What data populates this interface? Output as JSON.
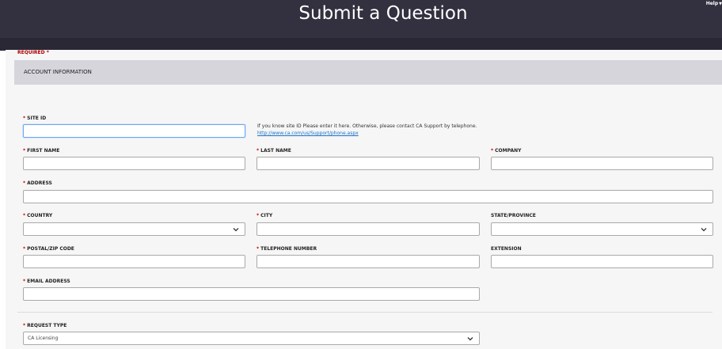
{
  "header": {
    "title": "Submit a Question",
    "help_label": "Help"
  },
  "section": {
    "title": "ACCOUNT INFORMATION",
    "required_note": "REQUIRED *"
  },
  "fields": {
    "site_id": {
      "label": "SITE ID",
      "required": true,
      "value": ""
    },
    "site_id_help": {
      "text": "If you know site ID Please enter it here. Otherwise, please contact CA Support by telephone.",
      "link": "http://www.ca.com/us/Support/phone.aspx"
    },
    "first_name": {
      "label": "FIRST NAME",
      "required": true,
      "value": ""
    },
    "last_name": {
      "label": "LAST NAME",
      "required": true,
      "value": ""
    },
    "company": {
      "label": "COMPANY",
      "required": true,
      "value": ""
    },
    "address": {
      "label": "ADDRESS",
      "required": true,
      "value": ""
    },
    "country": {
      "label": "COUNTRY",
      "required": true,
      "value": ""
    },
    "city": {
      "label": "CITY",
      "required": true,
      "value": ""
    },
    "state": {
      "label": "STATE/PROVINCE",
      "required": false,
      "value": ""
    },
    "postal": {
      "label": "POSTAL/ZIP CODE",
      "required": true,
      "value": ""
    },
    "telephone": {
      "label": "TELEPHONE NUMBER",
      "required": true,
      "value": ""
    },
    "extension": {
      "label": "EXTENSION",
      "required": false,
      "value": ""
    },
    "email": {
      "label": "EMAIL ADDRESS",
      "required": true,
      "value": ""
    },
    "request_type": {
      "label": "REQUEST TYPE",
      "required": true,
      "value": "CA Licensing"
    }
  },
  "icons": {
    "required_marker": "*",
    "dropdown": "chevron-down-icon",
    "help_caret": "caret-down-icon"
  },
  "colors": {
    "header_bg": "#33303f",
    "section_bg": "#d6d5dc",
    "required": "#b20000",
    "link": "#1a73c9",
    "focus": "#6ea7ec"
  }
}
